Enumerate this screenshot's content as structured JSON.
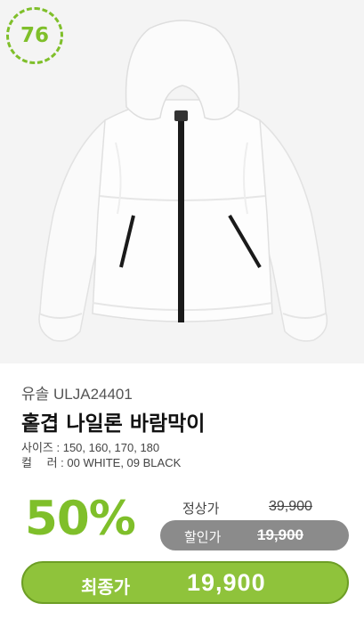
{
  "badge": {
    "number": "76"
  },
  "product": {
    "brand": "유솔 ULJA24401",
    "name": "홑겹 나일론 바람막이",
    "sizes": "사이즈 : 150, 160, 170, 180",
    "colors": "컬　 러 : 00 WHITE, 09 BLACK"
  },
  "pricing": {
    "discount_rate": "50%",
    "regular_label": "정상가",
    "regular_price": "39,900",
    "sale_label": "할인가",
    "sale_price": "19,900",
    "final_label": "최종가",
    "final_price": "19,900"
  },
  "colors": {
    "accent": "#8fc33b",
    "badge": "#7fbf2a",
    "sale_pill": "#8b8b8b"
  }
}
